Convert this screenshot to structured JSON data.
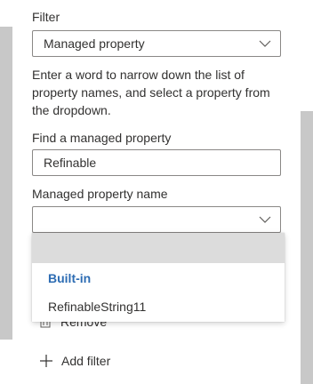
{
  "filter": {
    "label": "Filter",
    "selected": "Managed property"
  },
  "help_text": "Enter a word to narrow down the list of property names, and select a property from the dropdown.",
  "find": {
    "label": "Find a managed property",
    "value": "Refinable"
  },
  "property_name": {
    "label": "Managed property name",
    "selected": ""
  },
  "dropdown_menu": {
    "empty_option": "",
    "group_header": "Built-in",
    "items": [
      "RefinableString11"
    ]
  },
  "remove_label": "Remove",
  "add_filter_label": "Add filter",
  "colors": {
    "accent": "#2d6cb3",
    "text": "#323130",
    "border": "#8a8886",
    "overlay_gray": "#c8c8c8"
  },
  "icons": {
    "dropdown": "chevron-down-icon",
    "remove": "trash-icon",
    "add": "plus-icon"
  }
}
